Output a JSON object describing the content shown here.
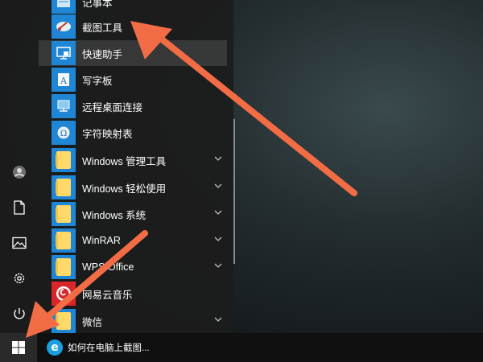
{
  "apps": {
    "notepad": "记事本",
    "snipping_tool": "截图工具",
    "quick_assist": "快速助手",
    "wordpad": "写字板",
    "remote_desktop": "远程桌面连接",
    "char_map": "字符映射表",
    "win_admin_tools": "Windows 管理工具",
    "win_ease_access": "Windows 轻松使用",
    "win_system": "Windows 系统",
    "winrar": "WinRAR",
    "wps_office": "WPS Office",
    "netease_music": "网易云音乐",
    "wechat": "微信"
  },
  "taskbar": {
    "active_window_title": "如何在电脑上截图..."
  },
  "colors": {
    "tile_blue": "#1f86d6",
    "folder_yellow": "#ffd968",
    "arrow_orange": "#f26d45",
    "netease_red": "#d8262a"
  },
  "icons": {
    "rail": [
      "user-icon",
      "document-icon",
      "pictures-icon",
      "settings-icon",
      "power-icon"
    ],
    "start": "windows-logo-icon"
  }
}
